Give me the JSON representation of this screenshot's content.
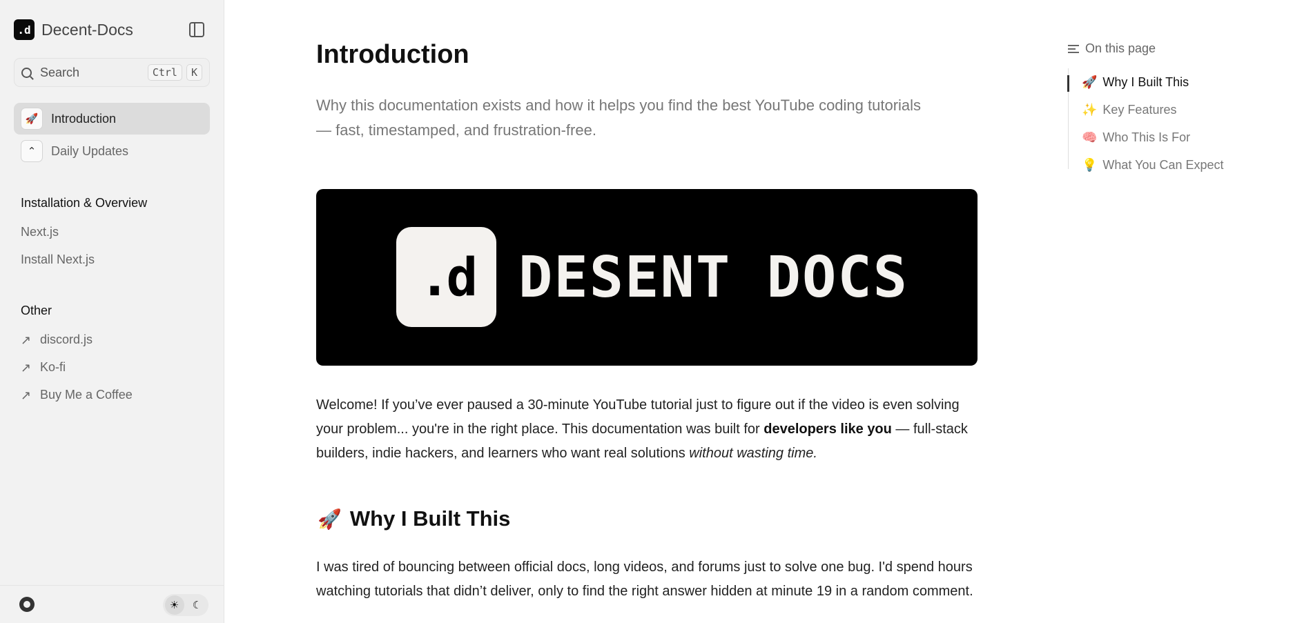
{
  "brand": {
    "logo_text": ".d",
    "name": "Decent-Docs"
  },
  "search": {
    "label": "Search",
    "key1": "Ctrl",
    "key2": "K"
  },
  "nav": [
    {
      "label": "Introduction",
      "icon": "rocket-icon",
      "active": true
    },
    {
      "label": "Daily Updates",
      "icon": "chevron-up-icon",
      "active": false
    }
  ],
  "sections": [
    {
      "title": "Installation & Overview",
      "links": [
        "Next.js",
        "Install Next.js"
      ]
    },
    {
      "title": "Other",
      "links": [
        "discord.js",
        "Ko-fi",
        "Buy Me a Coffee"
      ]
    }
  ],
  "main": {
    "title": "Introduction",
    "subtitle": "Why this documentation exists and how it helps you find the best YouTube coding tutorials — fast, timestamped, and frustration-free.",
    "hero_logo": ".d",
    "hero_text": "DESENT DOCS",
    "welcome_1": "Welcome! If you’ve ever paused a 30-minute YouTube tutorial just to figure out if the video is even solving your problem... you're in the right place. This documentation was built for ",
    "welcome_bold": "developers like you",
    "welcome_2": " — full-stack builders, indie hackers, and learners who want real solutions ",
    "welcome_italic": "without wasting time.",
    "section_emoji": "🚀",
    "section_heading": "Why I Built This",
    "body": "I was tired of bouncing between official docs, long videos, and forums just to solve one bug. I'd spend hours watching tutorials that didn’t deliver, only to find the right answer hidden at minute 19 in a random comment."
  },
  "toc": {
    "heading": "On this page",
    "items": [
      {
        "emoji": "🚀",
        "label": "Why I Built This",
        "active": true
      },
      {
        "emoji": "✨",
        "label": "Key Features",
        "active": false
      },
      {
        "emoji": "🧠",
        "label": "Who This Is For",
        "active": false
      },
      {
        "emoji": "💡",
        "label": "What You Can Expect",
        "active": false
      }
    ]
  },
  "colors": {
    "sidebar_bg": "#f2f2f2",
    "active_nav_bg": "#dcdcdc",
    "hero_bg": "#000000",
    "hero_fg": "#f4f2ef"
  }
}
